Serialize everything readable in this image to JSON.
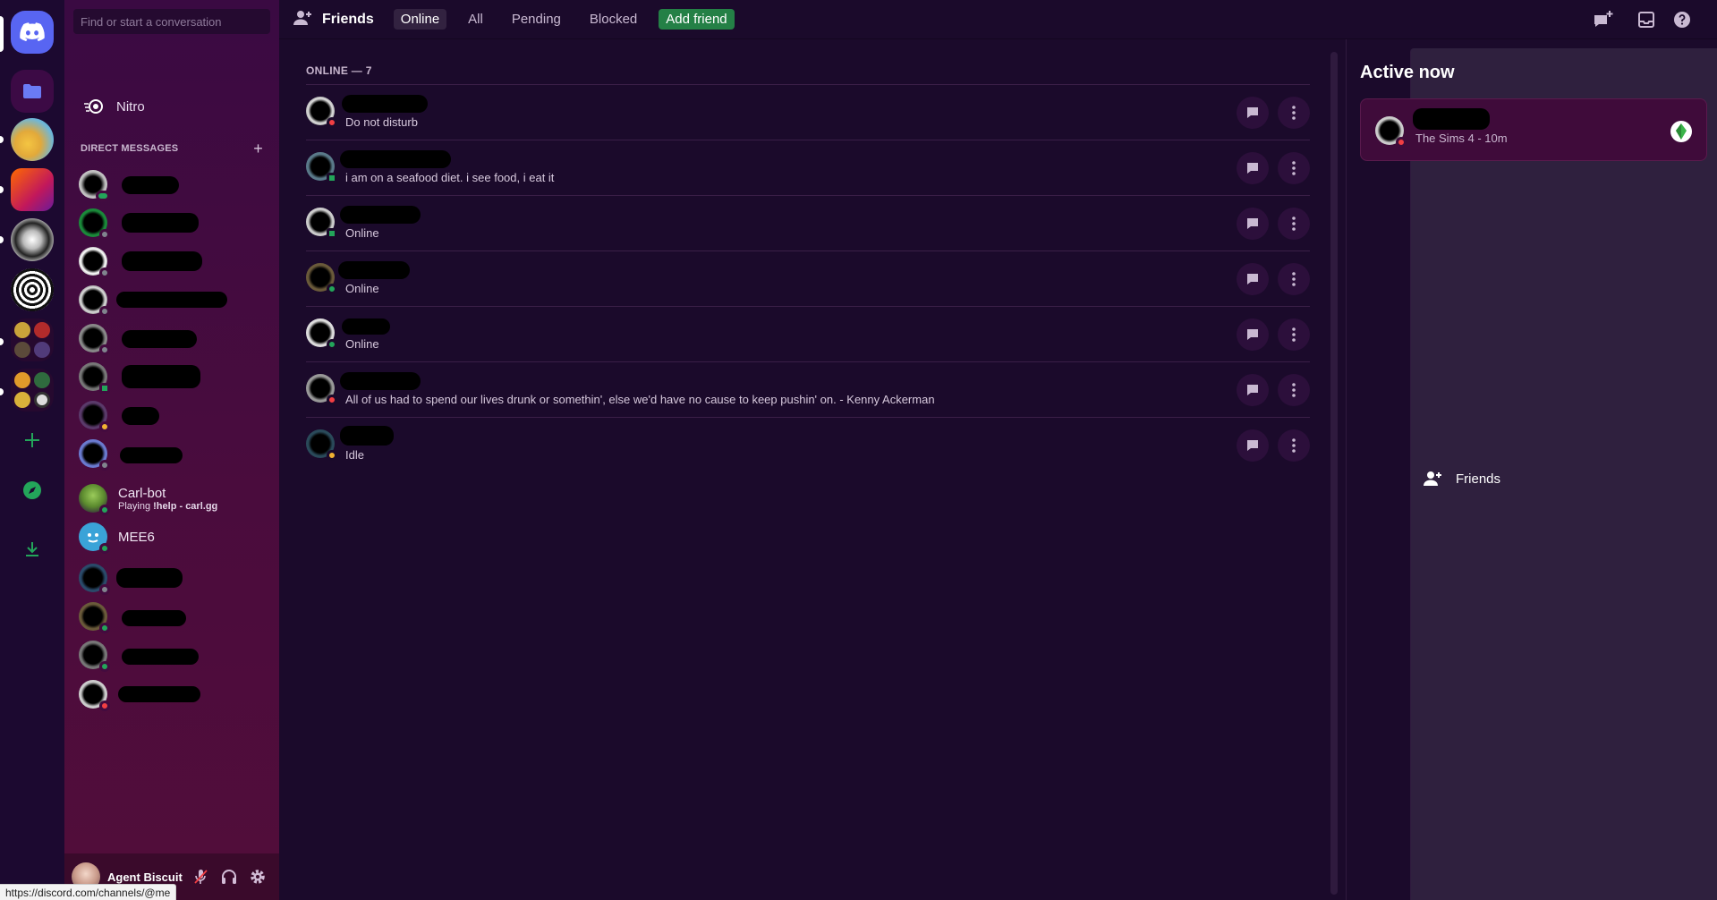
{
  "search": {
    "placeholder": "Find or start a conversation"
  },
  "sidebar": {
    "nav": [
      {
        "label": "Friends",
        "icon": "friends-icon",
        "active": true
      },
      {
        "label": "Nitro",
        "icon": "nitro-icon",
        "active": false
      }
    ],
    "dm_header": "DIRECT MESSAGES",
    "dm_add_icon": "plus-icon",
    "dms": [
      {
        "name": "",
        "status": "online-mobile"
      },
      {
        "name": "",
        "status": "offline"
      },
      {
        "name": "",
        "status": "offline"
      },
      {
        "name": "",
        "status": "offline"
      },
      {
        "name": "",
        "status": "offline"
      },
      {
        "name": "",
        "status": "online-mobile"
      },
      {
        "name": "",
        "status": "idle"
      },
      {
        "name": "",
        "status": "offline"
      },
      {
        "name": "Carl-bot",
        "sub_prefix": "Playing ",
        "sub_bold": "!help - carl.gg",
        "status": "online"
      },
      {
        "name": "MEE6",
        "status": "online"
      },
      {
        "name": "",
        "status": "offline"
      },
      {
        "name": "",
        "status": "online"
      },
      {
        "name": "",
        "status": "online"
      },
      {
        "name": "",
        "status": "dnd"
      }
    ]
  },
  "user_panel": {
    "username": "Agent Biscuit",
    "mute_icon": "microphone-muted-icon",
    "deafen_icon": "headphones-icon",
    "settings_icon": "gear-icon"
  },
  "status_url": "https://discord.com/channels/@me",
  "header": {
    "title": "Friends",
    "tabs": [
      "Online",
      "All",
      "Pending",
      "Blocked"
    ],
    "selected_tab": "Online",
    "add_friend": "Add friend",
    "icons": [
      "new-group-dm-icon",
      "inbox-icon",
      "help-icon"
    ]
  },
  "friends": {
    "heading": "ONLINE — 7",
    "rows": [
      {
        "status_text": "Do not disturb",
        "status": "dnd"
      },
      {
        "status_text": "i am on a seafood diet. i see food, i eat it",
        "status": "online-mobile"
      },
      {
        "status_text": "Online",
        "status": "online-mobile"
      },
      {
        "status_text": "Online",
        "status": "online"
      },
      {
        "status_text": "Online",
        "status": "online"
      },
      {
        "status_text": "All of us had to spend our lives drunk or somethin', else we'd have no cause to keep pushin' on. - Kenny Ackerman",
        "status": "dnd"
      },
      {
        "status_text": "Idle",
        "status": "idle"
      }
    ],
    "row_icons": [
      "message-icon",
      "more-vertical-icon"
    ]
  },
  "active_now": {
    "title": "Active now",
    "cards": [
      {
        "activity": "The Sims 4 - 10m",
        "game_icon": "plumbob-icon",
        "status": "dnd"
      }
    ]
  },
  "colors": {
    "online": "#23a55a",
    "idle": "#f0b232",
    "dnd": "#f23f43",
    "offline": "#80848e",
    "brand": "#5865f2",
    "add_friend": "#248046"
  }
}
